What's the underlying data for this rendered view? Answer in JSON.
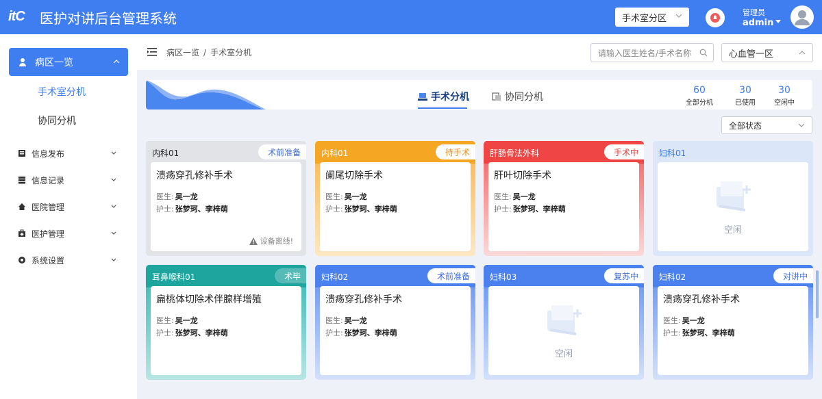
{
  "header": {
    "logo": "itC",
    "title": "医护对讲后台管理系统",
    "area_select": "手术室分区",
    "user_role": "管理员",
    "user_name": "admin"
  },
  "sidebar": {
    "active": "病区一览",
    "sub_items": [
      "手术室分机",
      "协同分机"
    ],
    "items": [
      {
        "label": "信息发布",
        "icon": "info-publish-icon"
      },
      {
        "label": "信息记录",
        "icon": "record-icon"
      },
      {
        "label": "医院管理",
        "icon": "home-icon"
      },
      {
        "label": "医护管理",
        "icon": "medical-kit-icon"
      },
      {
        "label": "系统设置",
        "icon": "gear-icon"
      }
    ]
  },
  "breadcrumb": [
    "病区一览",
    "手术室分机"
  ],
  "search": {
    "placeholder": "请输入医生姓名/手术名称"
  },
  "ward_select": "心血管一区",
  "tabs": [
    "手术分机",
    "协同分机"
  ],
  "stats": [
    {
      "num": "60",
      "label": "全部分机"
    },
    {
      "num": "30",
      "label": "已使用"
    },
    {
      "num": "30",
      "label": "空闲中"
    }
  ],
  "status_filter": "全部状态",
  "labels": {
    "doctor": "医生:",
    "nurse": "护士:"
  },
  "cards": [
    {
      "dept": "内科01",
      "badge": "术前准备",
      "title": "溃疡穿孔修补手术",
      "doctor": "吴一龙",
      "nurse": "张梦珂、李梓萌",
      "warning": "设备离线!"
    },
    {
      "dept": "内科01",
      "badge": "待手术",
      "title": "阑尾切除手术",
      "doctor": "吴一龙",
      "nurse": "张梦珂、李梓萌"
    },
    {
      "dept": "肝肠骨法外科",
      "badge": "手术中",
      "title": "肝叶切除手术",
      "doctor": "吴一龙",
      "nurse": "张梦珂、李梓萌"
    },
    {
      "dept": "妇科01",
      "idle": "空闲"
    },
    {
      "dept": "耳鼻喉科01",
      "badge": "术毕",
      "title": "扁桃体切除术伴腺样增殖",
      "doctor": "吴一龙",
      "nurse": "张梦珂、李梓萌"
    },
    {
      "dept": "妇科02",
      "badge": "术前准备",
      "title": "溃疡穿孔修补手术",
      "doctor": "吴一龙",
      "nurse": "张梦珂、李梓萌"
    },
    {
      "dept": "妇科03",
      "badge": "复苏中",
      "idle": "空闲"
    },
    {
      "dept": "妇科02",
      "badge": "对讲中",
      "title": "溃疡穿孔修补手术",
      "doctor": "吴一龙",
      "nurse": "张梦珂、李梓萌"
    }
  ]
}
